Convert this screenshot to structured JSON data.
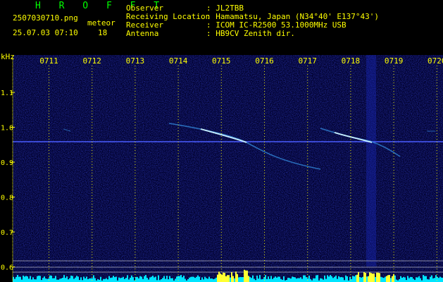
{
  "app": {
    "name": "H R O F F T"
  },
  "file": {
    "name": "2507030710.png",
    "datetime": "25.07.03 07:10"
  },
  "detection": {
    "label": "meteor",
    "count": "18"
  },
  "station": [
    {
      "key": "Observer",
      "value": ": JL2TBB"
    },
    {
      "key": "Receiving Location",
      "value": ": Hamamatsu, Japan (N34°40' E137°43')"
    },
    {
      "key": "Receiver",
      "value": ": ICOM IC-R2500 53.1000MHz USB"
    },
    {
      "key": "Antenna",
      "value": ": HB9CV Zenith dir."
    }
  ],
  "axis": {
    "unit": "kHz",
    "y_ticks": [
      "1.1",
      "1.0",
      "0.9",
      "0.8",
      "0.7",
      "0.6"
    ],
    "x_ticks": [
      "0711",
      "0712",
      "0713",
      "0714",
      "0715",
      "0716",
      "0717",
      "0718",
      "0719",
      "0720"
    ]
  },
  "colors": {
    "background": "#00002a",
    "text": "#ffff00",
    "logo": "#00ff00",
    "carrier": "#4a5cff",
    "echo": "#c8f0ff",
    "level": "#00e5ff",
    "level_peak": "#ffff33"
  }
}
